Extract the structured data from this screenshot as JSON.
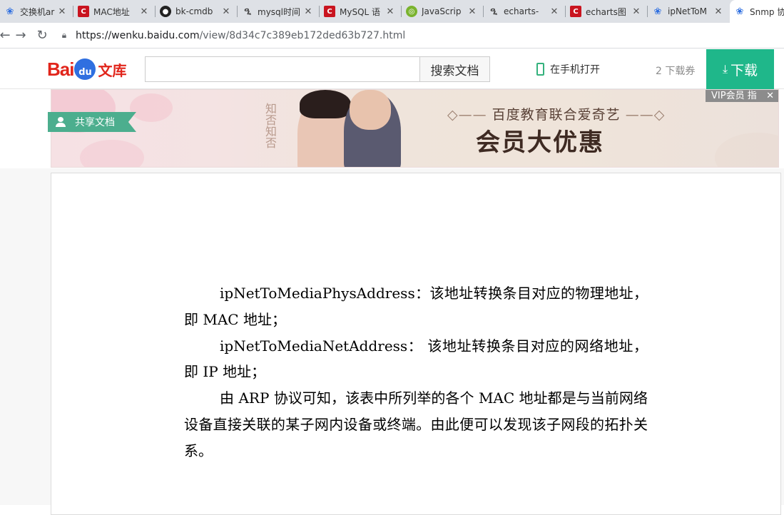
{
  "browser": {
    "tabs": [
      {
        "title": "交换机ar",
        "favicon": "baidu-paw-icon"
      },
      {
        "title": "MAC地址",
        "favicon": "csdn-icon"
      },
      {
        "title": "bk-cmdb",
        "favicon": "github-icon"
      },
      {
        "title": "mysql时间",
        "favicon": "segmentfault-icon"
      },
      {
        "title": "MySQL 语",
        "favicon": "csdn-icon"
      },
      {
        "title": "JavaScrip",
        "favicon": "green-icon"
      },
      {
        "title": "echarts-",
        "favicon": "segmentfault-icon"
      },
      {
        "title": "echarts图",
        "favicon": "csdn-icon"
      },
      {
        "title": "ipNetToM",
        "favicon": "baidu-paw-icon"
      },
      {
        "title": "Snmp 协",
        "favicon": "baidu-paw-icon"
      }
    ],
    "close_glyph": "✕",
    "url_host": "https://wenku.baidu.com",
    "url_path": "/view/8d34c7c389eb172ded63b727.html"
  },
  "header": {
    "logo_bai": "Bai",
    "logo_du": "du",
    "logo_wenku": "文库",
    "search_placeholder": "",
    "search_button": "搜索文档",
    "phone_open": "在手机打开",
    "coupons": "2 下载券",
    "download": "下载"
  },
  "banner": {
    "vertical_text": "知否知否",
    "title": "百度教育联合爱奇艺",
    "big": "会员大优惠",
    "vip_tag": "VIP会员 指"
  },
  "share_tag": "共享文档",
  "document": {
    "paragraphs": [
      "ipNetToMediaPhysAddress：该地址转换条目对应的物理地址，即 MAC 地址；",
      "ipNetToMediaNetAddress： 该地址转换条目对应的网络地址，即 IP 地址；",
      "由 ARP 协议可知，该表中所列举的各个 MAC 地址都是与当前网络设备直接关联的某子网内设备或终端。由此便可以发现该子网段的拓扑关系。"
    ]
  },
  "colors": {
    "accent_green": "#1fb78a",
    "share_green": "#4cae8e",
    "baidu_red": "#e1251b",
    "baidu_blue": "#2f6fe0"
  }
}
